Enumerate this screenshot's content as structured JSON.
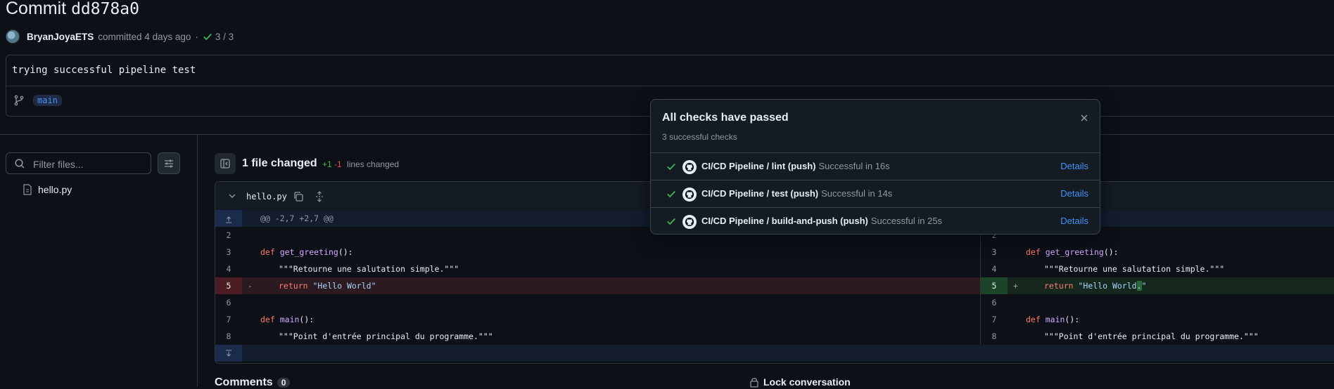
{
  "header": {
    "title_prefix": "Commit",
    "commit_hash": "dd878a0",
    "author": "BryanJoyaETS",
    "committed_text": "committed 4 days ago",
    "separator": "·",
    "checks_count": "3 / 3"
  },
  "commit": {
    "message": "trying successful pipeline test",
    "branch": "main"
  },
  "sidebar": {
    "filter_placeholder": "Filter files...",
    "files": [
      "hello.py"
    ]
  },
  "diff_toolbar": {
    "files_changed": "1 file changed",
    "additions": "+1",
    "deletions": "-1",
    "lines_changed_label": "lines changed"
  },
  "diff": {
    "filename": "hello.py",
    "hunk_header": "@@ -2,7 +2,7 @@",
    "left_lines": [
      "2",
      "3",
      "4",
      "5",
      "6",
      "7",
      "8"
    ],
    "right_lines": [
      "2",
      "3",
      "4",
      "5",
      "6",
      "7",
      "8"
    ],
    "del_marker": "-",
    "add_marker": "+",
    "code": {
      "def": "def",
      "get_greeting": "get_greeting",
      "parens": "():",
      "doc_greeting": "\"\"\"Retourne une salutation simple.\"\"\"",
      "return_kw": "return",
      "old_str": "\"Hello World\"",
      "new_str_a": "\"Hello World",
      "new_str_b": ".",
      "new_str_c": "\"",
      "main": "main",
      "doc_main": "\"\"\"Point d'entrée principal du programme.\"\"\""
    }
  },
  "footer": {
    "comments_label": "Comments",
    "comments_count": "0",
    "lock_label": "Lock conversation"
  },
  "checks_popover": {
    "title": "All checks have passed",
    "subtitle": "3 successful checks",
    "items": [
      {
        "name": "CI/CD Pipeline / lint (push)",
        "status": "Successful in 16s",
        "link": "Details"
      },
      {
        "name": "CI/CD Pipeline / test (push)",
        "status": "Successful in 14s",
        "link": "Details"
      },
      {
        "name": "CI/CD Pipeline / build-and-push (push)",
        "status": "Successful in 25s",
        "link": "Details"
      }
    ]
  },
  "colors": {
    "background": "#0d1117",
    "success": "#3fb950",
    "danger": "#f85149",
    "accent": "#4493f8"
  },
  "icons": [
    "check-icon",
    "branch-icon",
    "search-icon",
    "sliders-icon",
    "file-icon",
    "sidebar-collapse-icon",
    "chevron-down-icon",
    "copy-icon",
    "unfold-icon",
    "expand-up-icon",
    "expand-down-icon",
    "close-icon",
    "github-icon",
    "lock-icon"
  ]
}
